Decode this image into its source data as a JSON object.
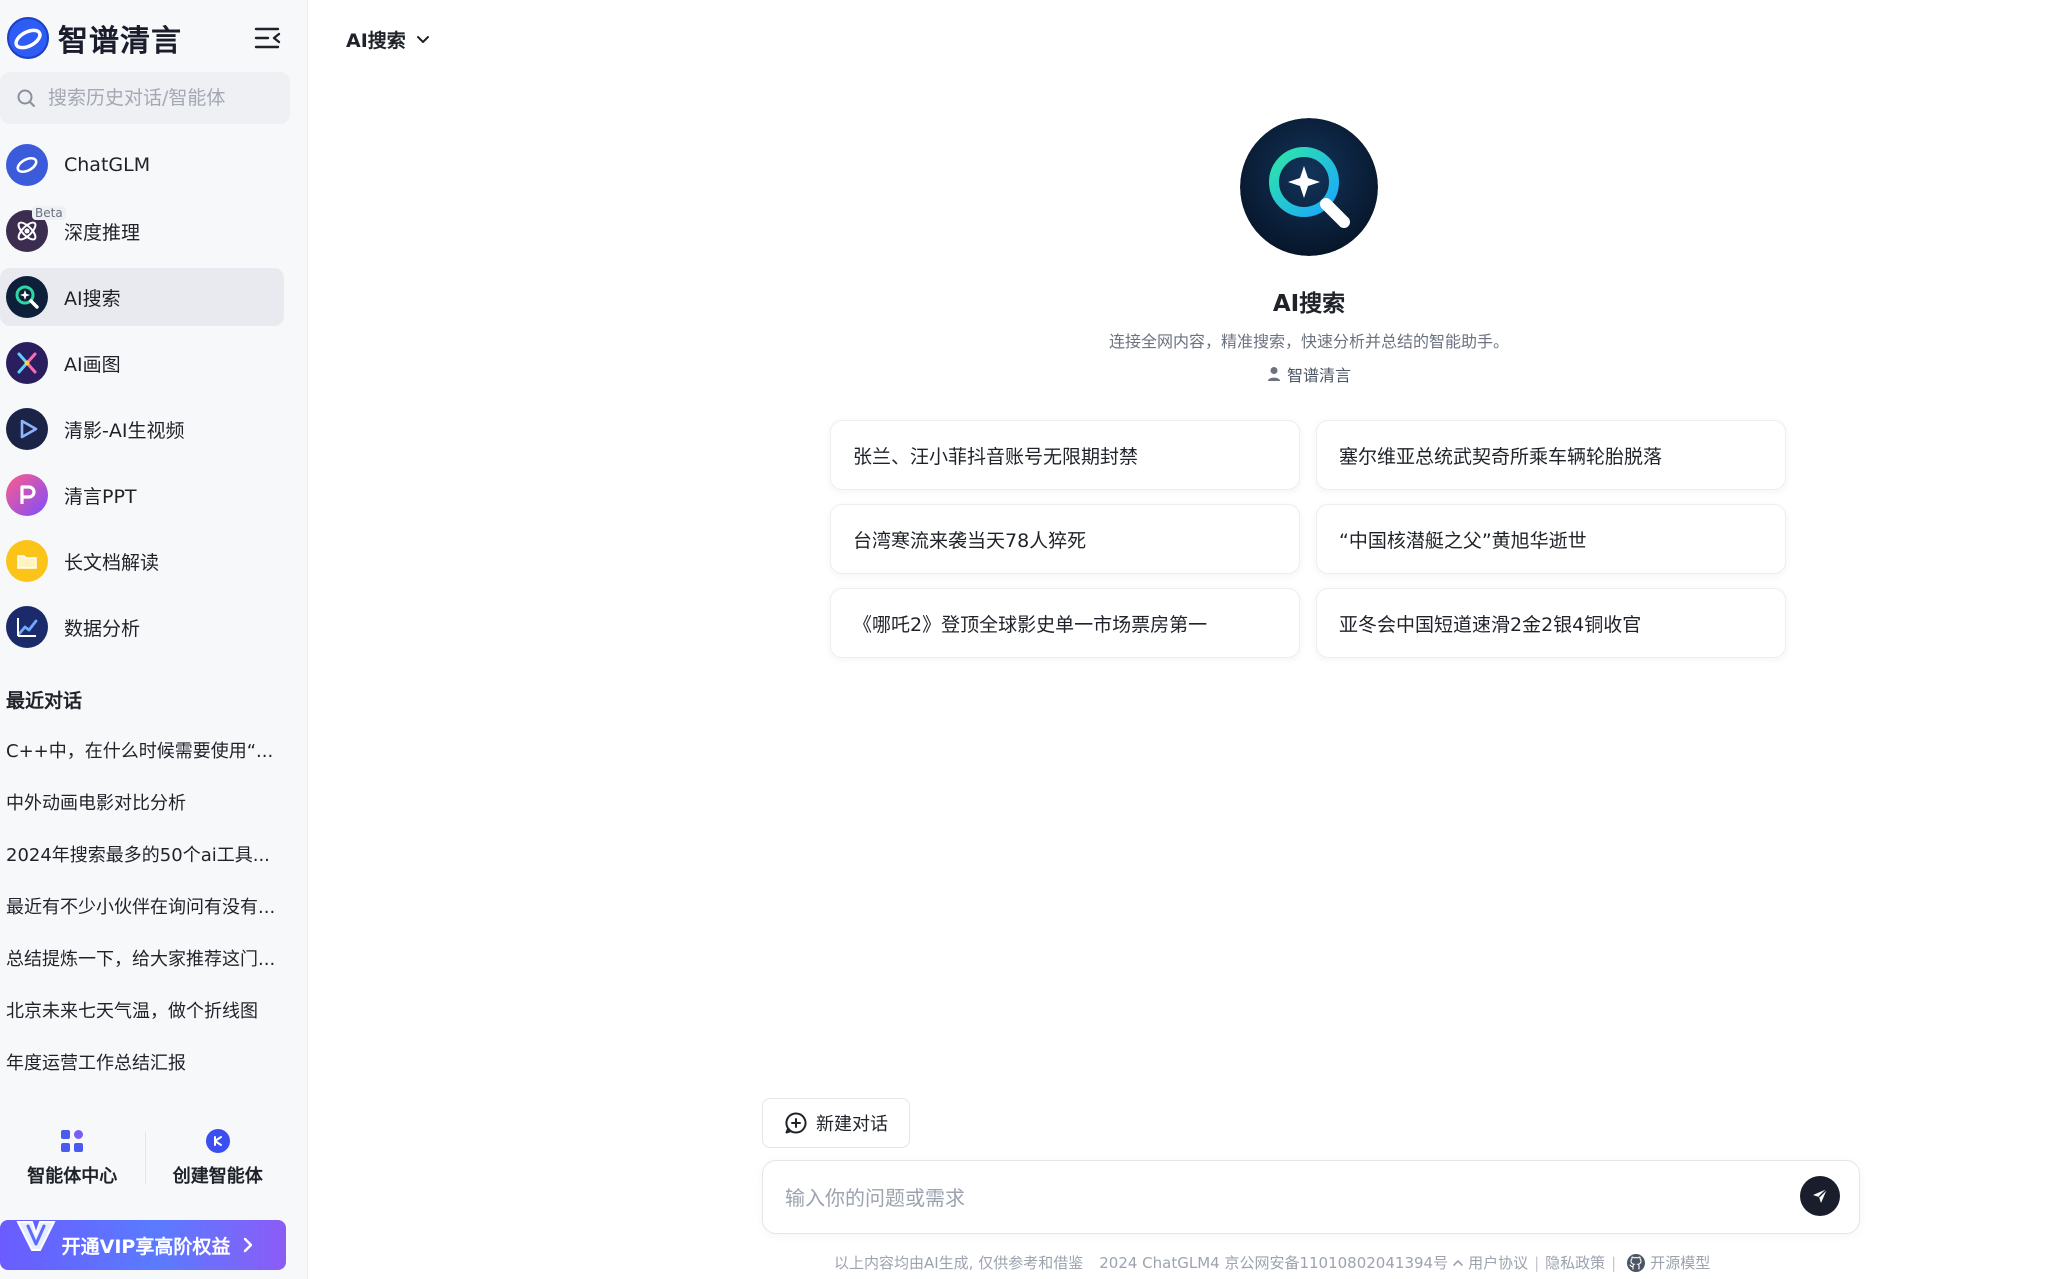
{
  "brand": {
    "name": "智谱清言",
    "logo_icon": "chatglm-logo-icon"
  },
  "sidebar": {
    "search_placeholder": "搜索历史对话/智能体",
    "nav_items": [
      {
        "label": "ChatGLM",
        "icon": "chatglm-icon",
        "color": "#3b5bdb"
      },
      {
        "label": "深度推理",
        "icon": "reasoning-icon",
        "badge": "Beta",
        "color": "#3a2d4f"
      },
      {
        "label": "AI搜索",
        "icon": "ai-search-icon",
        "active": true,
        "color": "#0e1f3a"
      },
      {
        "label": "AI画图",
        "icon": "ai-draw-icon",
        "color": "#2b1e5e"
      },
      {
        "label": "清影-AI生视频",
        "icon": "ai-video-icon",
        "color": "#1b2446"
      },
      {
        "label": "清言PPT",
        "icon": "ppt-icon",
        "color": "#d6336c"
      },
      {
        "label": "长文档解读",
        "icon": "document-icon",
        "color": "#fcc419"
      },
      {
        "label": "数据分析",
        "icon": "data-analysis-icon",
        "color": "#1b2a6b"
      }
    ],
    "recent_title": "最近对话",
    "recent_items": [
      "C++中，在什么时候需要使用“...",
      "中外动画电影对比分析",
      "2024年搜索最多的50个ai工具...",
      "最近有不少小伙伴在询问有没有...",
      "总结提炼一下，给大家推荐这门...",
      "北京未来七天气温，做个折线图",
      "年度运营工作总结汇报"
    ],
    "agent_center_label": "智能体中心",
    "create_agent_label": "创建智能体",
    "vip_label": "开通VIP享高阶权益"
  },
  "header": {
    "model_label": "AI搜索"
  },
  "agent": {
    "title": "AI搜索",
    "description": "连接全网内容，精准搜索，快速分析并总结的智能助手。",
    "author": "智谱清言"
  },
  "suggestions": [
    "张兰、汪小菲抖音账号无限期封禁",
    "塞尔维亚总统武契奇所乘车辆轮胎脱落",
    "台湾寒流来袭当天78人猝死",
    "“中国核潜艇之父”黄旭华逝世",
    "《哪吒2》登顶全球影史单一市场票房第一",
    "亚冬会中国短道速滑2金2银4铜收官"
  ],
  "composer": {
    "new_chat_label": "新建对话",
    "input_placeholder": "输入你的问题或需求",
    "input_value": ""
  },
  "footer": {
    "disclaimer": "以上内容均由AI生成, 仅供参考和借鉴",
    "copyright": "2024 ChatGLM4 京公网安备11010802041394号",
    "user_agreement": "用户协议",
    "privacy_policy": "隐私政策",
    "open_source": "开源模型",
    "sep": "|"
  },
  "colors": {
    "accent": "#1a1d2b",
    "vip_gradient_start": "#6a5cff",
    "vip_gradient_end": "#8b5cf6"
  }
}
